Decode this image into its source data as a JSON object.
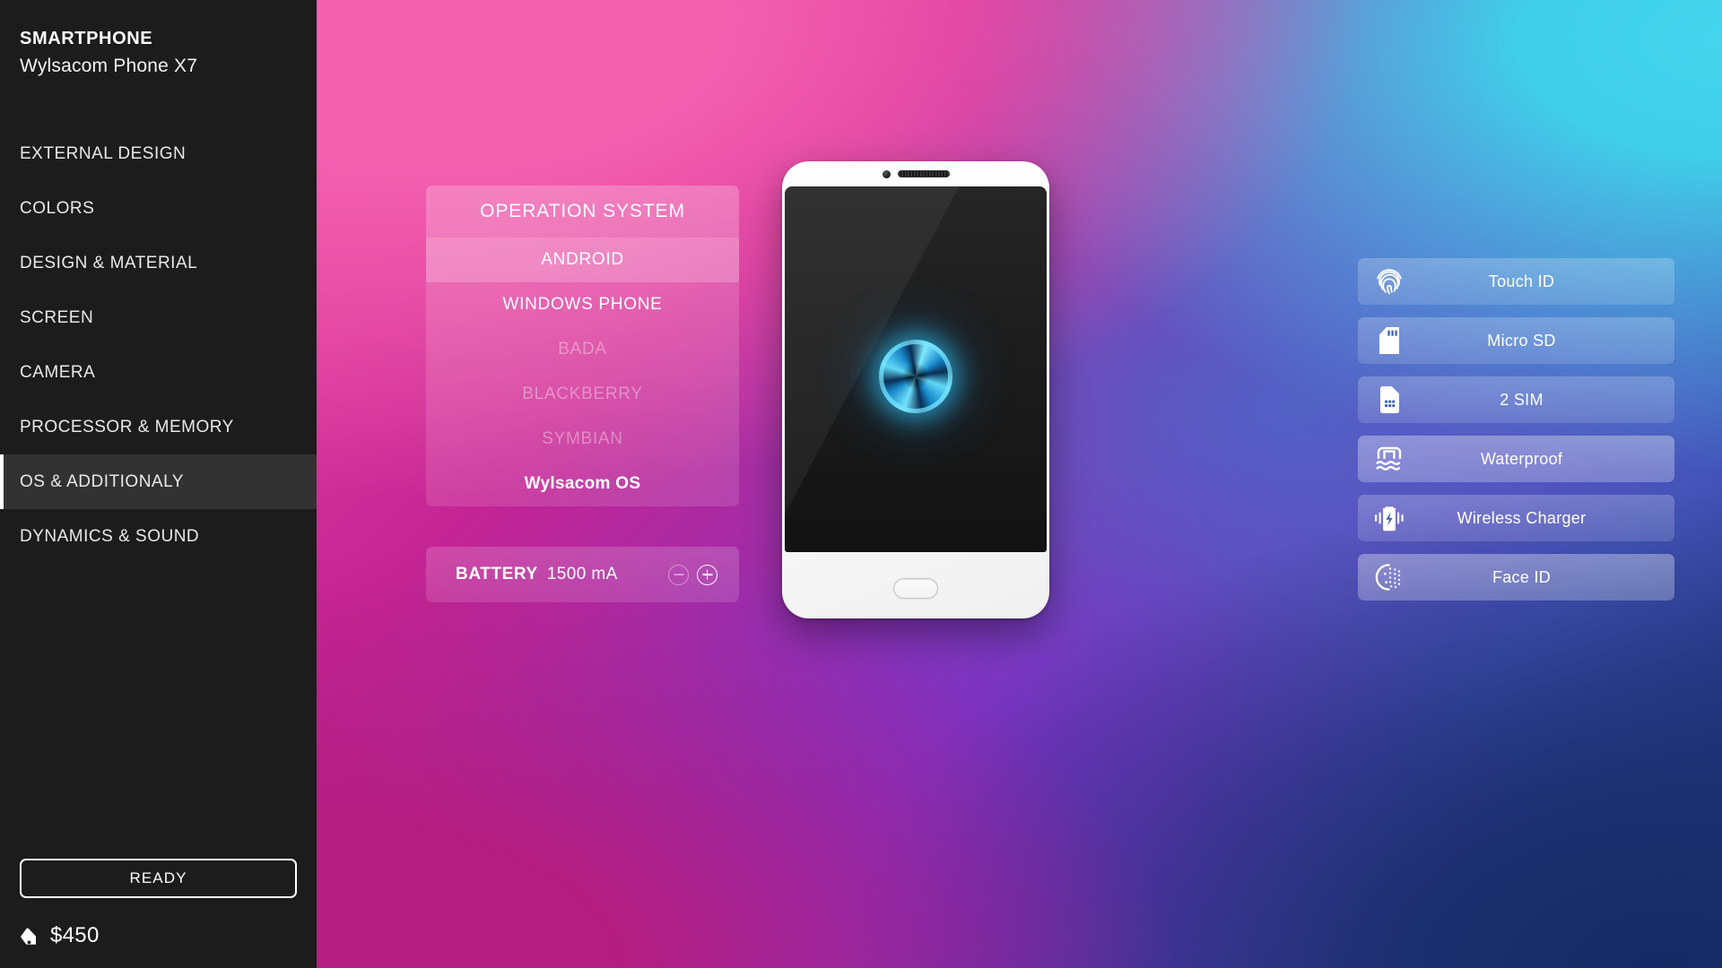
{
  "sidebar": {
    "brand_title": "SMARTPHONE",
    "brand_model": "Wylsacom Phone X7",
    "items": [
      {
        "label": "EXTERNAL DESIGN",
        "active": false
      },
      {
        "label": "COLORS",
        "active": false
      },
      {
        "label": "DESIGN & MATERIAL",
        "active": false
      },
      {
        "label": "SCREEN",
        "active": false
      },
      {
        "label": "CAMERA",
        "active": false
      },
      {
        "label": "PROCESSOR & MEMORY",
        "active": false
      },
      {
        "label": "OS & ADDITIONALY",
        "active": true
      },
      {
        "label": "DYNAMICS & SOUND",
        "active": false
      }
    ],
    "ready_label": "READY",
    "price": "$450",
    "price_icon": "price-tag-icon"
  },
  "os_panel": {
    "header": "OPERATION SYSTEM",
    "options": [
      {
        "label": "ANDROID",
        "state": "selected"
      },
      {
        "label": "WINDOWS PHONE",
        "state": "available"
      },
      {
        "label": "BADA",
        "state": "disabled"
      },
      {
        "label": "BLACKBERRY",
        "state": "disabled"
      },
      {
        "label": "SYMBIAN",
        "state": "disabled"
      },
      {
        "label": "Wylsacom OS",
        "state": "custom"
      }
    ]
  },
  "battery": {
    "label": "BATTERY",
    "value": "1500 mA",
    "decrement_icon": "minus-circle-icon",
    "increment_icon": "plus-circle-icon",
    "decrement_enabled": false,
    "increment_enabled": true
  },
  "phone": {
    "camera_icon": "front-camera-icon",
    "speaker_icon": "earpiece-speaker-icon",
    "orb_icon": "screen-orb-icon",
    "home_button_icon": "home-button-icon"
  },
  "features": [
    {
      "label": "Touch ID",
      "icon": "fingerprint-icon",
      "enabled": false
    },
    {
      "label": "Micro SD",
      "icon": "sd-card-icon",
      "enabled": false
    },
    {
      "label": "2 SIM",
      "icon": "sim-card-icon",
      "enabled": false
    },
    {
      "label": "Waterproof",
      "icon": "waterproof-icon",
      "enabled": true
    },
    {
      "label": "Wireless Charger",
      "icon": "wireless-charger-icon",
      "enabled": false
    },
    {
      "label": "Face ID",
      "icon": "face-id-icon",
      "enabled": true
    }
  ],
  "colors": {
    "sidebar_bg": "#1c1c1c",
    "sidebar_active_bg": "#323232",
    "accent_white": "#ffffff",
    "bg_pink": "#e8459f",
    "bg_magenta": "#c52594",
    "bg_purple": "#7c35bd",
    "bg_blue": "#3f4fb5",
    "bg_cyan": "#3fcfe9",
    "bg_navy": "#1e2f74",
    "orb_cyan": "#36c9f2"
  }
}
